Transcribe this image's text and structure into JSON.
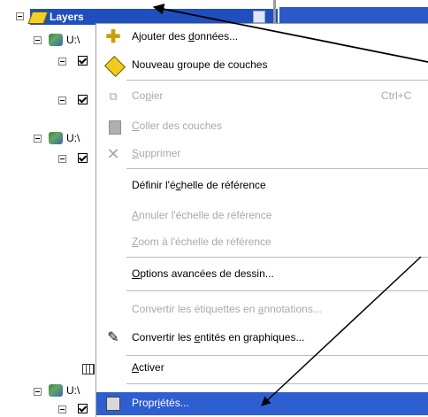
{
  "toc": {
    "root_label": "Layers",
    "layer_labels": [
      "U:\\",
      "U:\\",
      "U:\\"
    ]
  },
  "context_menu": {
    "items": [
      {
        "pre": "Ajouter des ",
        "acc": "d",
        "post": "onnées...",
        "shortcut": "",
        "icon": "add-data-icon",
        "state": "enabled"
      },
      {
        "pre": "Nouveau ",
        "acc": "g",
        "post": "roupe de couches",
        "shortcut": "",
        "icon": "new-group-icon",
        "state": "enabled"
      },
      {
        "pre": "Co",
        "acc": "p",
        "post": "ier",
        "shortcut": "Ctrl+C",
        "icon": "copy-icon",
        "state": "disabled"
      },
      {
        "pre": "",
        "acc": "C",
        "post": "oller des couches",
        "shortcut": "",
        "icon": "paste-icon",
        "state": "disabled"
      },
      {
        "pre": "",
        "acc": "S",
        "post": "upprimer",
        "shortcut": "",
        "icon": "delete-icon",
        "state": "disabled"
      },
      {
        "pre": "Définir l'é",
        "acc": "c",
        "post": "helle de référence",
        "shortcut": "",
        "icon": "",
        "state": "enabled"
      },
      {
        "pre": "",
        "acc": "A",
        "post": "nnuler l'échelle de référence",
        "shortcut": "",
        "icon": "",
        "state": "disabled"
      },
      {
        "pre": "",
        "acc": "Z",
        "post": "oom à l'échelle de référence",
        "shortcut": "",
        "icon": "",
        "state": "disabled"
      },
      {
        "pre": "",
        "acc": "O",
        "post": "ptions avancées de dessin...",
        "shortcut": "",
        "icon": "",
        "state": "enabled"
      },
      {
        "pre": "Convertir les étiquettes en ",
        "acc": "a",
        "post": "nnotations...",
        "shortcut": "",
        "icon": "",
        "state": "disabled"
      },
      {
        "pre": "Convertir les ",
        "acc": "e",
        "post": "ntités en graphiques...",
        "shortcut": "",
        "icon": "convert-graphics-icon",
        "state": "enabled"
      },
      {
        "pre": "",
        "acc": "A",
        "post": "ctiver",
        "shortcut": "",
        "icon": "",
        "state": "enabled"
      },
      {
        "pre": "Propr",
        "acc": "i",
        "post": "étés...",
        "shortcut": "",
        "icon": "properties-icon",
        "state": "selected"
      }
    ]
  },
  "colors": {
    "menu_highlight": "#2d5fd0",
    "title_bar": "#1f4fbf",
    "disabled_text": "#a8a8a8"
  }
}
